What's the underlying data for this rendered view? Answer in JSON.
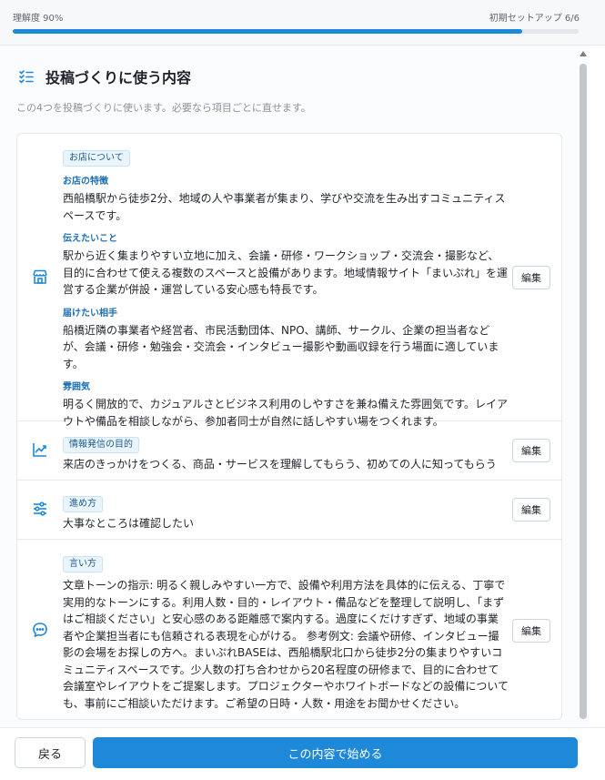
{
  "header": {
    "understanding_label": "理解度 90%",
    "understanding_progress_percent": 90,
    "setup_label": "初期セットアップ 6/6",
    "accent_color": "#1e88d9"
  },
  "section": {
    "icon": "checklist-icon",
    "title": "投稿づくりに使う内容",
    "subtitle": "この4つを投稿づくりに使います。必要なら項目ごとに直せます。"
  },
  "rows": [
    {
      "icon": "store-icon",
      "tag": "お店について",
      "items": [
        {
          "label": "お店の特徴",
          "text": "西船橋駅から徒歩2分、地域の人や事業者が集まり、学びや交流を生み出すコミュニティスペースです。"
        },
        {
          "label": "伝えたいこと",
          "text": "駅から近く集まりやすい立地に加え、会議・研修・ワークショップ・交流会・撮影など、目的に合わせて使える複数のスペースと設備があります。地域情報サイト「まいぷれ」を運営する企業が併設・運営している安心感も特長です。"
        },
        {
          "label": "届けたい相手",
          "text": "船橋近隣の事業者や経営者、市民活動団体、NPO、講師、サークル、企業の担当者などが、会議・研修・勉強会・交流会・インタビュー撮影や動画収録を行う場面に適しています。"
        },
        {
          "label": "雰囲気",
          "text": "明るく開放的で、カジュアルさとビジネス利用のしやすさを兼ね備えた雰囲気です。レイアウトや備品を相談しながら、参加者同士が自然に話しやすい場をつくれます。"
        }
      ],
      "edit_label": "編集"
    },
    {
      "icon": "trend-chart-icon",
      "tag": "情報発信の目的",
      "text": "来店のきっかけをつくる、商品・サービスを理解してもらう、初めての人に知ってもらう",
      "edit_label": "編集"
    },
    {
      "icon": "sliders-icon",
      "tag": "進め方",
      "text": "大事なところは確認したい",
      "edit_label": "編集"
    },
    {
      "icon": "chat-bubble-icon",
      "tag": "言い方",
      "text": "文章トーンの指示: 明るく親しみやすい一方で、設備や利用方法を具体的に伝える、丁寧で実用的なトーンにする。利用人数・目的・レイアウト・備品などを整理して説明し、「まずはご相談ください」と安心感のある距離感で案内する。過度にくだけすぎず、地域の事業者や企業担当者にも信頼される表現を心がける。 参考例文: 会議や研修、インタビュー撮影の会場をお探しの方へ。まいぷれBASEは、西船橋駅北口から徒歩2分の集まりやすいコミュニティスペースです。少人数の打ち合わせから20名程度の研修まで、目的に合わせて会議室やレイアウトをご提案します。プロジェクターやホワイトボードなどの設備についても、事前にご相談いただけます。ご希望の日時・人数・用途をお聞かせください。",
      "edit_label": "編集"
    }
  ],
  "footer": {
    "back_label": "戻る",
    "start_label": "この内容で始める"
  }
}
